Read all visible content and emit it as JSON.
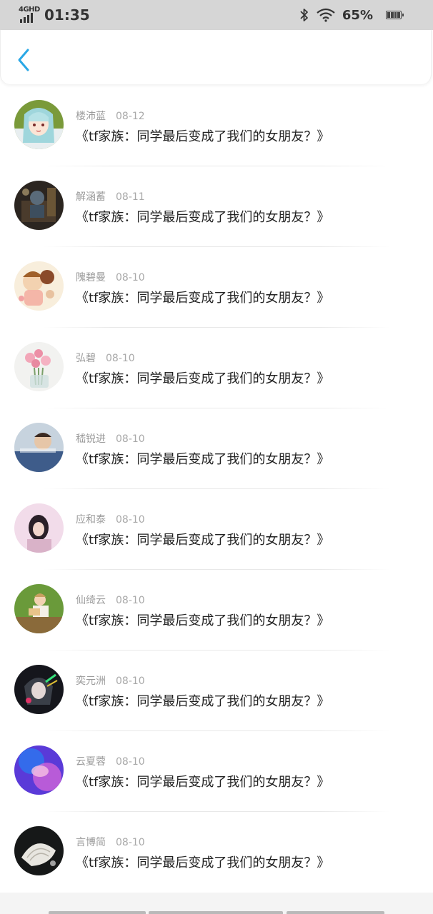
{
  "status_bar": {
    "network": "4GHD",
    "time": "01:35",
    "battery_percent": "65%",
    "icons": [
      "signal-icon",
      "bluetooth-icon",
      "wifi-icon",
      "battery-icon"
    ]
  },
  "nav": {
    "back_icon": "chevron-left-icon",
    "accent_color": "#2aa8e6"
  },
  "messages": [
    {
      "name": "楼沛蓝",
      "date": "08-12",
      "title": "《tf家族：同学最后变成了我们的女朋友？》"
    },
    {
      "name": "解涵蓄",
      "date": "08-11",
      "title": "《tf家族：同学最后变成了我们的女朋友？》"
    },
    {
      "name": "隗碧曼",
      "date": "08-10",
      "title": "《tf家族：同学最后变成了我们的女朋友？》"
    },
    {
      "name": "弘碧",
      "date": "08-10",
      "title": "《tf家族：同学最后变成了我们的女朋友？》"
    },
    {
      "name": "嵇锐进",
      "date": "08-10",
      "title": "《tf家族：同学最后变成了我们的女朋友？》"
    },
    {
      "name": "应和泰",
      "date": "08-10",
      "title": "《tf家族：同学最后变成了我们的女朋友？》"
    },
    {
      "name": "仙绮云",
      "date": "08-10",
      "title": "《tf家族：同学最后变成了我们的女朋友？》"
    },
    {
      "name": "奕元洲",
      "date": "08-10",
      "title": "《tf家族：同学最后变成了我们的女朋友？》"
    },
    {
      "name": "云夏蓉",
      "date": "08-10",
      "title": "《tf家族：同学最后变成了我们的女朋友？》"
    },
    {
      "name": "言博简",
      "date": "08-10",
      "title": "《tf家族：同学最后变成了我们的女朋友？》"
    }
  ]
}
